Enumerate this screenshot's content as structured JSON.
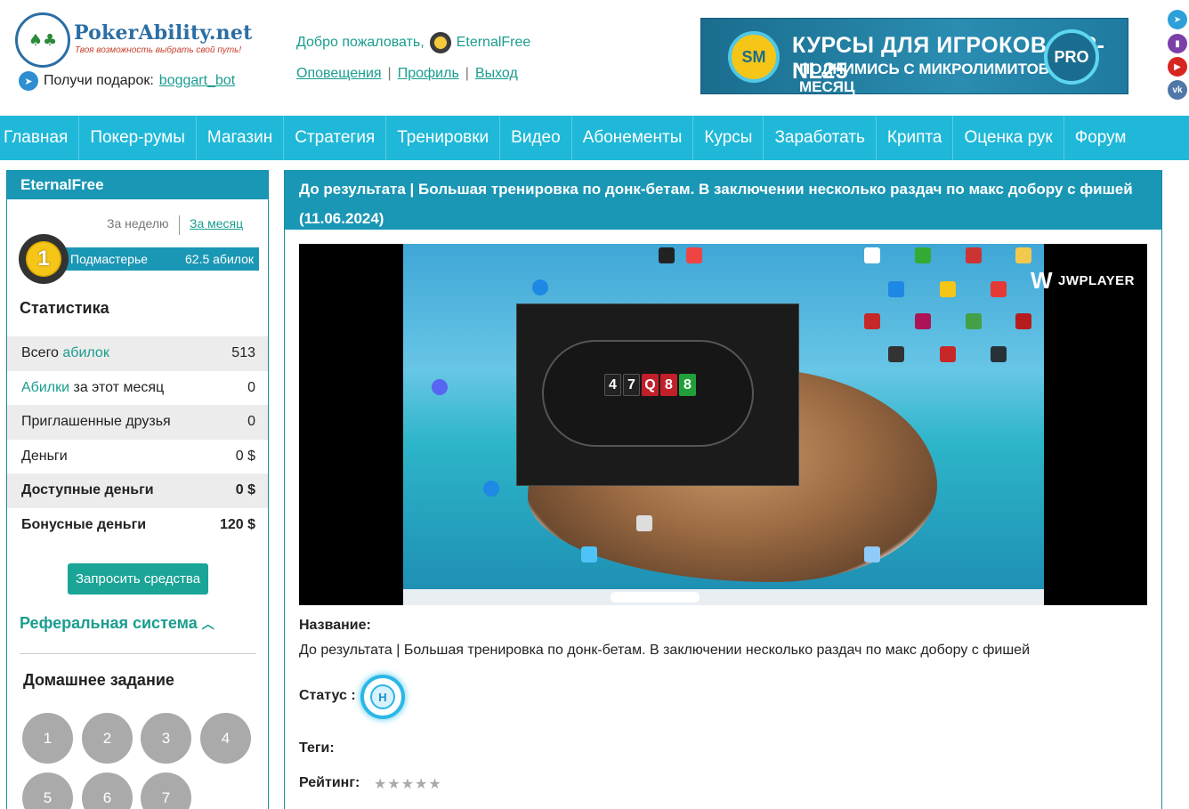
{
  "header": {
    "logo_name": "PokerAbility",
    "logo_domain": ".net",
    "logo_tagline": "Твоя возможность выбрать свой путь!",
    "gift_label": "Получи подарок:",
    "gift_link": "boggart_bot",
    "welcome": "Добро пожаловать,",
    "username": "EternalFree",
    "links": [
      "Оповещения",
      "Профиль",
      "Выход"
    ],
    "banner": {
      "badge": "SM",
      "line1": "КУРСЫ ДЛЯ ИГРОКОВ NL2-NL25",
      "line2": "ПОДНИМИСЬ С МИКРОЛИМИТОВ ЗА МЕСЯЦ",
      "pro": "PRO"
    },
    "social": [
      "telegram-icon",
      "twitch-icon",
      "youtube-icon",
      "vk-icon"
    ]
  },
  "nav": [
    "Главная",
    "Покер-румы",
    "Магазин",
    "Стратегия",
    "Тренировки",
    "Видео",
    "Абонементы",
    "Курсы",
    "Заработать",
    "Крипта",
    "Оценка рук",
    "Форум"
  ],
  "sidebar": {
    "username": "EternalFree",
    "period_week": "За неделю",
    "period_month": "За месяц",
    "rank_number": "1",
    "rank_name": "Подмастерье",
    "rank_points": "62.5 абилок",
    "stats_title": "Статистика",
    "stats": [
      {
        "label_pre": "Всего ",
        "label_link": "абилок",
        "label_post": "",
        "value": "513"
      },
      {
        "label_pre": "",
        "label_link": "Абилки",
        "label_post": " за этот месяц",
        "value": "0"
      },
      {
        "label_pre": "Приглашенные друзья",
        "label_link": "",
        "label_post": "",
        "value": "0"
      },
      {
        "label_pre": "Деньги",
        "label_link": "",
        "label_post": "",
        "value": "0 $"
      },
      {
        "label_pre": "Доступные деньги",
        "label_link": "",
        "label_post": "",
        "value": "0 $"
      },
      {
        "label_pre": "Бонусные деньги",
        "label_link": "",
        "label_post": "",
        "value": "120 $"
      }
    ],
    "request_button": "Запросить средства",
    "referral": "Реферальная система",
    "homework_title": "Домашнее задание",
    "homework": [
      "1",
      "2",
      "3",
      "4",
      "5",
      "6",
      "7"
    ]
  },
  "main": {
    "header": "До результата | Большая тренировка по донк-бетам. В заключении несколько раздач по макс добору с фишей (11.06.2024)",
    "player_brand": "JWPLAYER",
    "board_cards": [
      "4",
      "7",
      "Q",
      "8",
      "8"
    ],
    "name_label": "Название:",
    "name_value": "До результата | Большая тренировка по донк-бетам. В заключении несколько раздач по макс добору с фишей",
    "status_label": "Статус :",
    "status_badge": "H",
    "tags_label": "Теги:",
    "rating_label": "Рейтинг:",
    "rating_stars": "★★★★★",
    "rating_value": 0
  },
  "colors": {
    "accent": "#1fb8d8",
    "header_bar": "#1a97b5",
    "link": "#1a9d8f",
    "button": "#1aa596"
  }
}
